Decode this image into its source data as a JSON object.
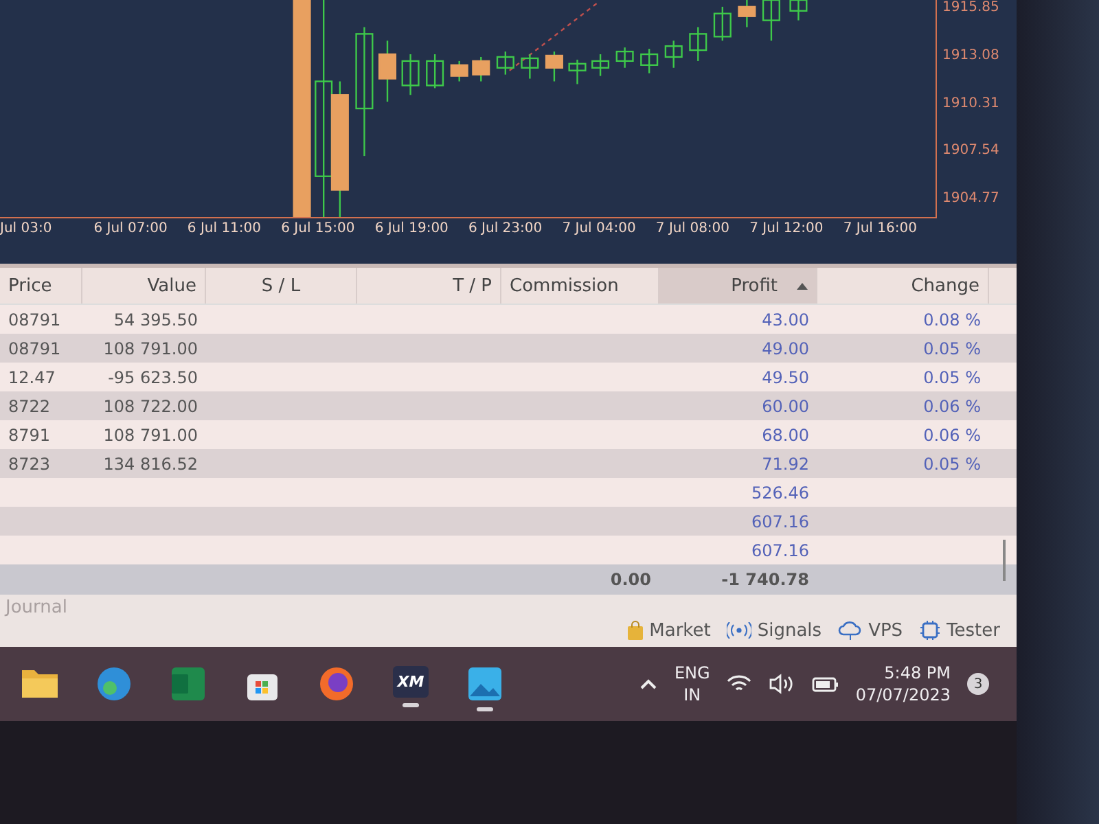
{
  "chart": {
    "price_labels": [
      "1915.85",
      "1913.08",
      "1910.31",
      "1907.54",
      "1904.77"
    ],
    "time_labels": [
      "Jul 03:0",
      "6 Jul 07:00",
      "6 Jul 11:00",
      "6 Jul 15:00",
      "6 Jul 19:00",
      "6 Jul 23:00",
      "7 Jul 04:00",
      "7 Jul 08:00",
      "7 Jul 12:00",
      "7 Jul 16:00"
    ]
  },
  "table": {
    "columns": [
      {
        "label": "Price",
        "sorted": false
      },
      {
        "label": "Value",
        "sorted": false
      },
      {
        "label": "S / L",
        "sorted": false
      },
      {
        "label": "T / P",
        "sorted": false
      },
      {
        "label": "Commission",
        "sorted": false
      },
      {
        "label": "Profit",
        "sorted": true
      },
      {
        "label": "Change",
        "sorted": false
      }
    ],
    "rows": [
      {
        "price": "08791",
        "value": "54 395.50",
        "profit": "43.00",
        "change": "0.08 %"
      },
      {
        "price": "08791",
        "value": "108 791.00",
        "profit": "49.00",
        "change": "0.05 %"
      },
      {
        "price": "12.47",
        "value": "-95 623.50",
        "profit": "49.50",
        "change": "0.05 %"
      },
      {
        "price": "8722",
        "value": "108 722.00",
        "profit": "60.00",
        "change": "0.06 %"
      },
      {
        "price": "8791",
        "value": "108 791.00",
        "profit": "68.00",
        "change": "0.06 %"
      },
      {
        "price": "8723",
        "value": "134 816.52",
        "profit": "71.92",
        "change": "0.05 %"
      },
      {
        "profit": "526.46"
      },
      {
        "profit": "607.16"
      },
      {
        "profit": "607.16"
      }
    ],
    "total": {
      "commission": "0.00",
      "profit": "-1 740.78"
    }
  },
  "toolbox": {
    "journal_tab": "Journal",
    "links": [
      "Market",
      "Signals",
      "VPS",
      "Tester"
    ]
  },
  "taskbar": {
    "apps": [
      {
        "running": false
      },
      {
        "running": false
      },
      {
        "running": false
      },
      {
        "running": false
      },
      {
        "running": false
      },
      {
        "running": true,
        "text": "XM"
      },
      {
        "running": true
      }
    ],
    "language": "ENG",
    "region": "IN",
    "time": "5:48 PM",
    "date": "07/07/2023",
    "notifications": "3"
  }
}
